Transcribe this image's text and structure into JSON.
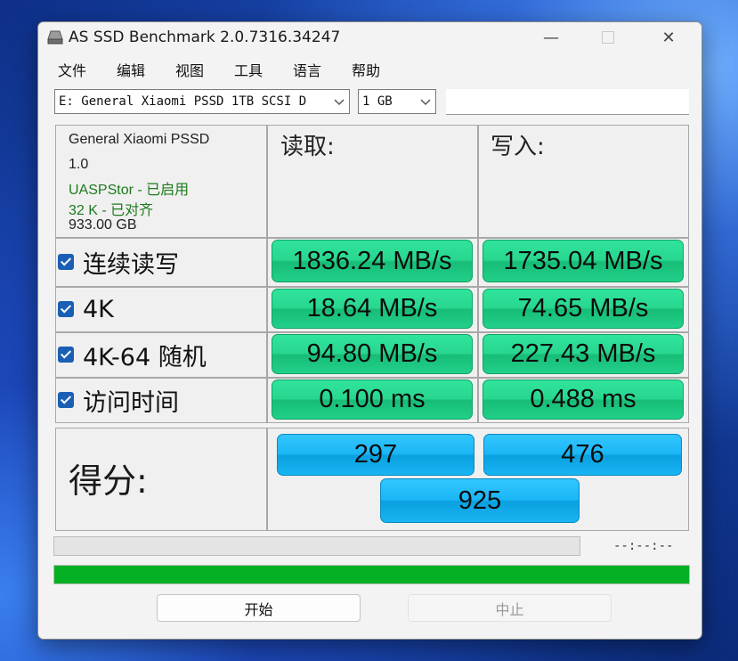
{
  "window": {
    "title": "AS SSD Benchmark 2.0.7316.34247",
    "minimize": "—",
    "close": "✕"
  },
  "menu": [
    "文件",
    "编辑",
    "视图",
    "工具",
    "语言",
    "帮助"
  ],
  "drive_select": {
    "value": "E: General Xiaomi PSSD 1TB SCSI D"
  },
  "size_select": {
    "value": "1 GB"
  },
  "drive_info": {
    "name": "General Xiaomi PSSD",
    "firmware": "1.0",
    "uasp": "UASPStor - 已启用",
    "alignment": "32 K - 已对齐",
    "capacity": "933.00 GB"
  },
  "headers": {
    "read": "读取:",
    "write": "写入:"
  },
  "tests": [
    {
      "label": "连续读写",
      "checked": true,
      "read": "1836.24 MB/s",
      "write": "1735.04 MB/s"
    },
    {
      "label": "4K",
      "checked": true,
      "read": "18.64 MB/s",
      "write": "74.65 MB/s"
    },
    {
      "label": "4K-64 随机",
      "checked": true,
      "read": "94.80 MB/s",
      "write": "227.43 MB/s"
    },
    {
      "label": "访问时间",
      "checked": true,
      "read": "0.100 ms",
      "write": "0.488 ms"
    }
  ],
  "score": {
    "label": "得分:",
    "read": "297",
    "write": "476",
    "total": "925"
  },
  "progress": {
    "elapsed": "--:--:--",
    "test_progress": 0,
    "overall_progress": 1
  },
  "buttons": {
    "start": "开始",
    "stop": "中止"
  },
  "colors": {
    "result_green": "#28d68f",
    "score_blue": "#1ab6f5",
    "progress_green": "#06b025",
    "uasp_text": "#1e7a1e"
  }
}
